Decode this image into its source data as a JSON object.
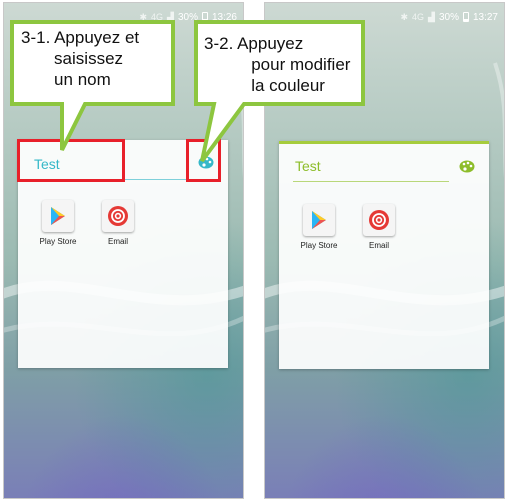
{
  "screens": [
    {
      "status_time": "13:26",
      "status_battery": "30%",
      "status_network": "4G",
      "folder_name": "Test",
      "apps": [
        {
          "label": "Play Store",
          "icon": "play-store-icon"
        },
        {
          "label": "Email",
          "icon": "email-icon"
        }
      ]
    },
    {
      "status_time": "13:27",
      "status_battery": "30%",
      "status_network": "4G",
      "folder_name": "Test",
      "apps": [
        {
          "label": "Play Store",
          "icon": "play-store-icon"
        },
        {
          "label": "Email",
          "icon": "email-icon"
        }
      ]
    }
  ],
  "callouts": [
    {
      "step": "3-1.",
      "text": "3-1. Appuyez et\n       saisissez\n       un nom"
    },
    {
      "step": "3-2.",
      "text": "3-2. Appuyez\n          pour modifier\n          la couleur"
    }
  ],
  "colors": {
    "highlight": "#e8202a",
    "callout_border": "#8dc63f",
    "folder_name_default": "#35b8c8",
    "folder_name_changed": "#8dbd2a"
  }
}
